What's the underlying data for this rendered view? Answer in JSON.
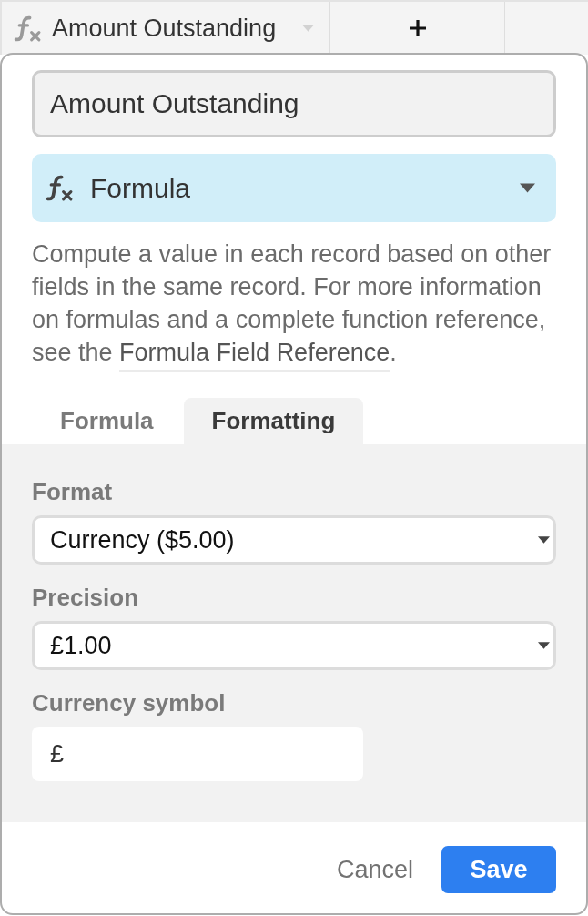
{
  "column_header": {
    "title": "Amount Outstanding"
  },
  "field_name": {
    "value": "Amount Outstanding"
  },
  "field_type": {
    "label": "Formula"
  },
  "description": {
    "before": "Compute a value in each record based on other fields in the same record. For more information on formulas and a complete function reference, see the ",
    "link": "Formula Field Reference",
    "after": "."
  },
  "tabs": [
    {
      "label": "Formula",
      "selected": false
    },
    {
      "label": "Formatting",
      "selected": true
    }
  ],
  "formatting": {
    "fields": [
      {
        "kind": "select",
        "label": "Format",
        "value": "Currency ($5.00)"
      },
      {
        "kind": "select",
        "label": "Precision",
        "value": "£1.00"
      },
      {
        "kind": "text",
        "label": "Currency symbol",
        "value": "£"
      }
    ]
  },
  "buttons": [
    {
      "kind": "cancel",
      "label": "Cancel"
    },
    {
      "kind": "save",
      "label": "Save"
    }
  ]
}
